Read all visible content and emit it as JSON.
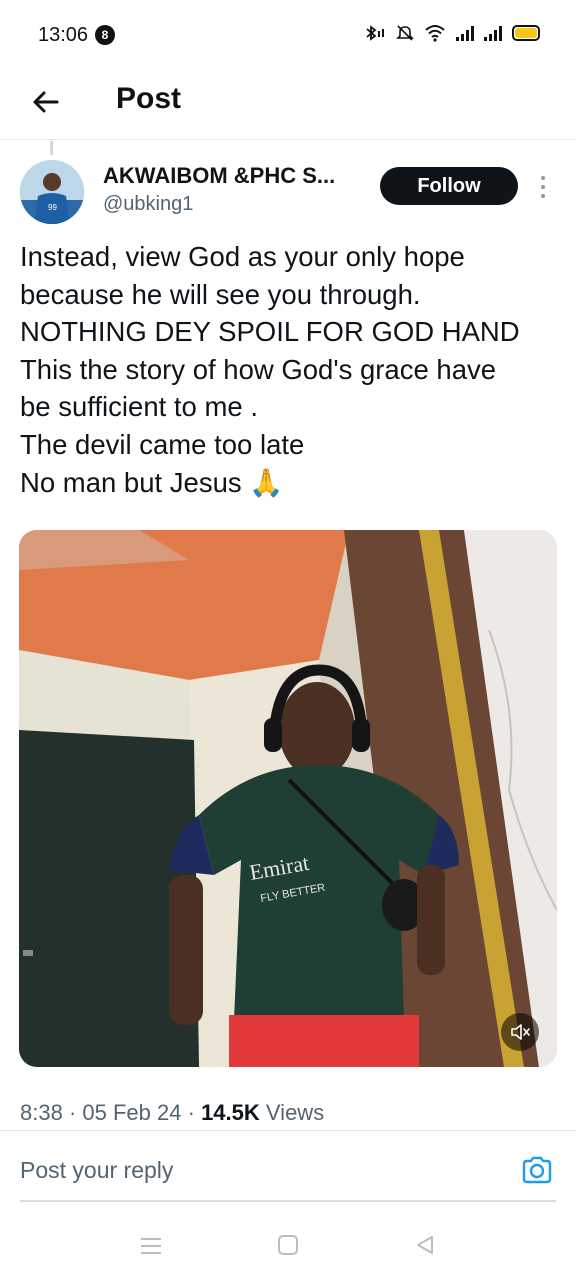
{
  "status_bar": {
    "time": "13:06",
    "notification_count": "8",
    "icons": [
      "bluetooth-icon",
      "mute-icon",
      "wifi-icon",
      "signal-icon",
      "signal-icon",
      "battery-icon"
    ],
    "battery_color": "#f5c518"
  },
  "header": {
    "title": "Post",
    "back_icon": "arrow-left-icon"
  },
  "post": {
    "author_name": "AKWAIBOM &PHC S...",
    "author_handle": "@ubking1",
    "follow_label": "Follow",
    "text_lines": [
      "Instead, view God as your only hope",
      "because he will see you through.",
      "NOTHING DEY SPOIL FOR GOD HAND",
      "This the story of how God's grace have",
      "be sufficient to me .",
      "The devil came too late",
      "No man but Jesus 🙏"
    ],
    "media": {
      "type": "video",
      "jersey_text": "Emirates FLY BETTER",
      "mute_icon": "speaker-muted-icon"
    },
    "time": "8:38",
    "date": "05 Feb 24",
    "views_count": "14.5K",
    "views_label": "Views"
  },
  "reply": {
    "placeholder": "Post your reply",
    "camera_icon": "camera-icon"
  },
  "nav_bar": {
    "icons": [
      "recents-icon",
      "home-icon",
      "back-icon"
    ]
  },
  "colors": {
    "text_primary": "#0f1419",
    "text_secondary": "#536471",
    "accent": "#1d9bf0",
    "follow_button": "#0f1419"
  }
}
